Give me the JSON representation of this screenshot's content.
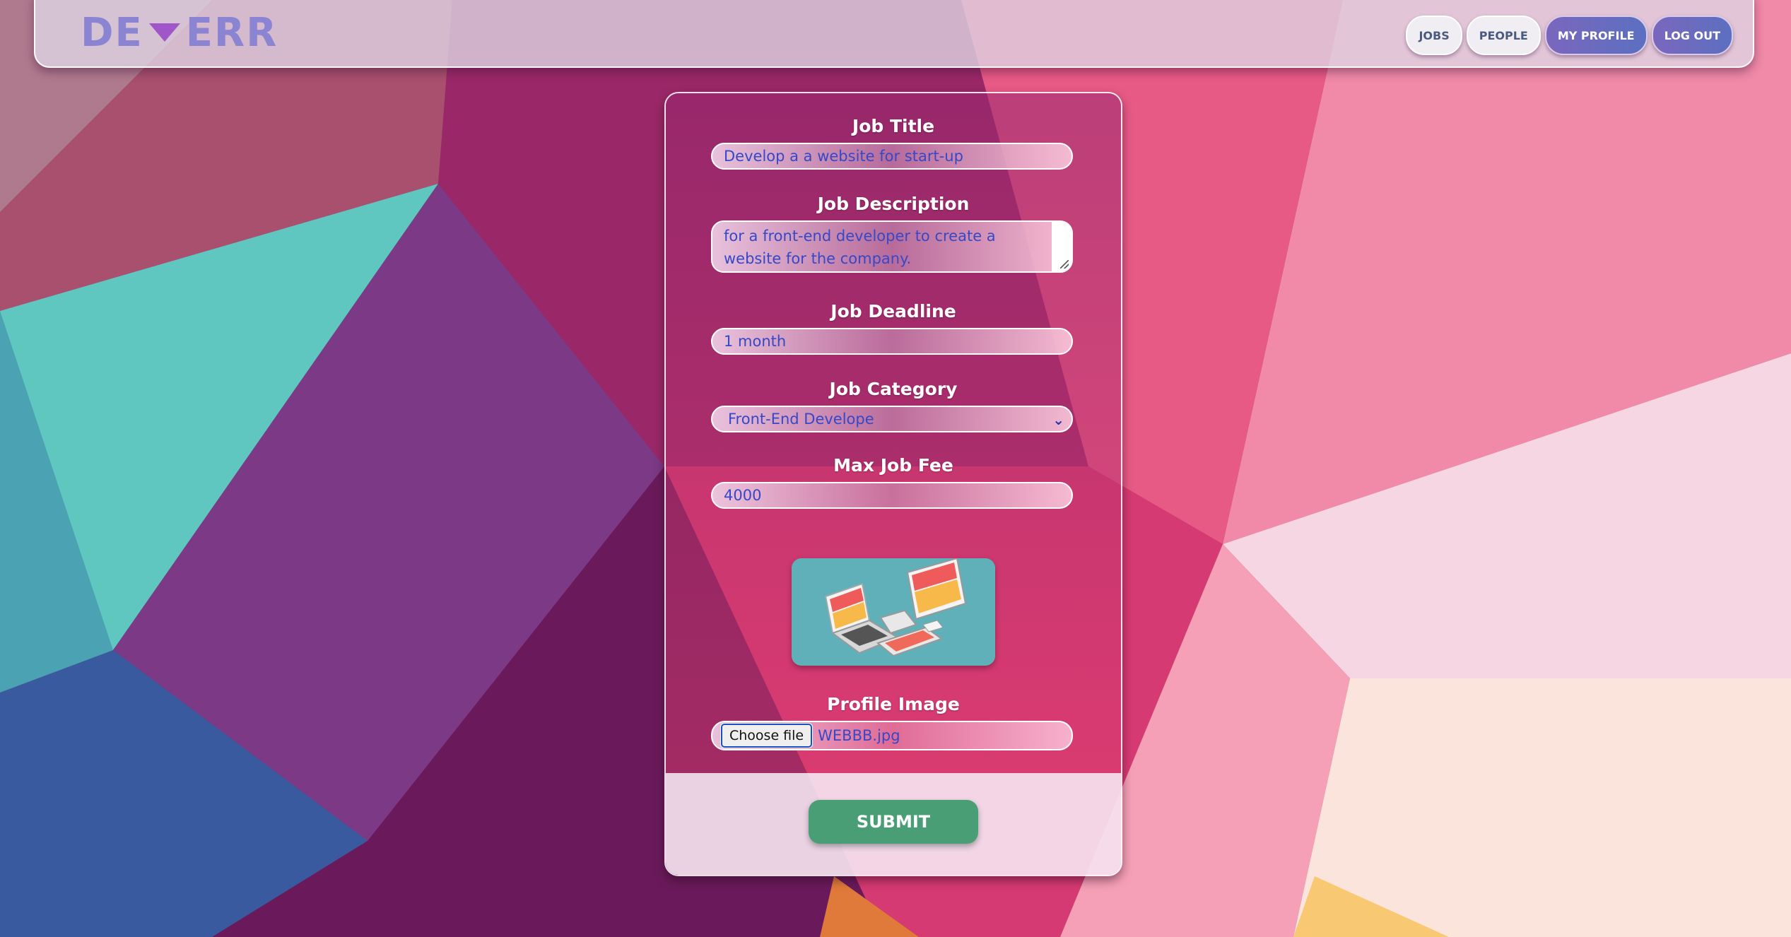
{
  "header": {
    "logo_left": "DE",
    "logo_right": "ERR",
    "nav": [
      {
        "label": "JOBS"
      },
      {
        "label": "PEOPLE"
      },
      {
        "label": "MY PROFILE"
      },
      {
        "label": "LOG OUT"
      }
    ]
  },
  "form": {
    "job_title": {
      "label": "Job Title",
      "value": "Develop a a website for start-up"
    },
    "job_description": {
      "label": "Job Description",
      "value": "for a front-end developer to create a website for the company."
    },
    "job_deadline": {
      "label": "Job Deadline",
      "value": "1 month"
    },
    "job_category": {
      "label": "Job Category",
      "value": "Front-End Develope"
    },
    "max_job_fee": {
      "label": "Max Job Fee",
      "value": "4000"
    },
    "profile_image": {
      "label": "Profile Image",
      "button": "Choose file",
      "file_name": "WEBBB.jpg"
    },
    "submit_label": "SUBMIT"
  },
  "icons": {
    "select": "chevron-down-icon",
    "preview": "devices-illustration"
  },
  "colors": {
    "submit": "#4a9e76",
    "input_text": "#3548c8",
    "logo": "#8a84d2"
  }
}
